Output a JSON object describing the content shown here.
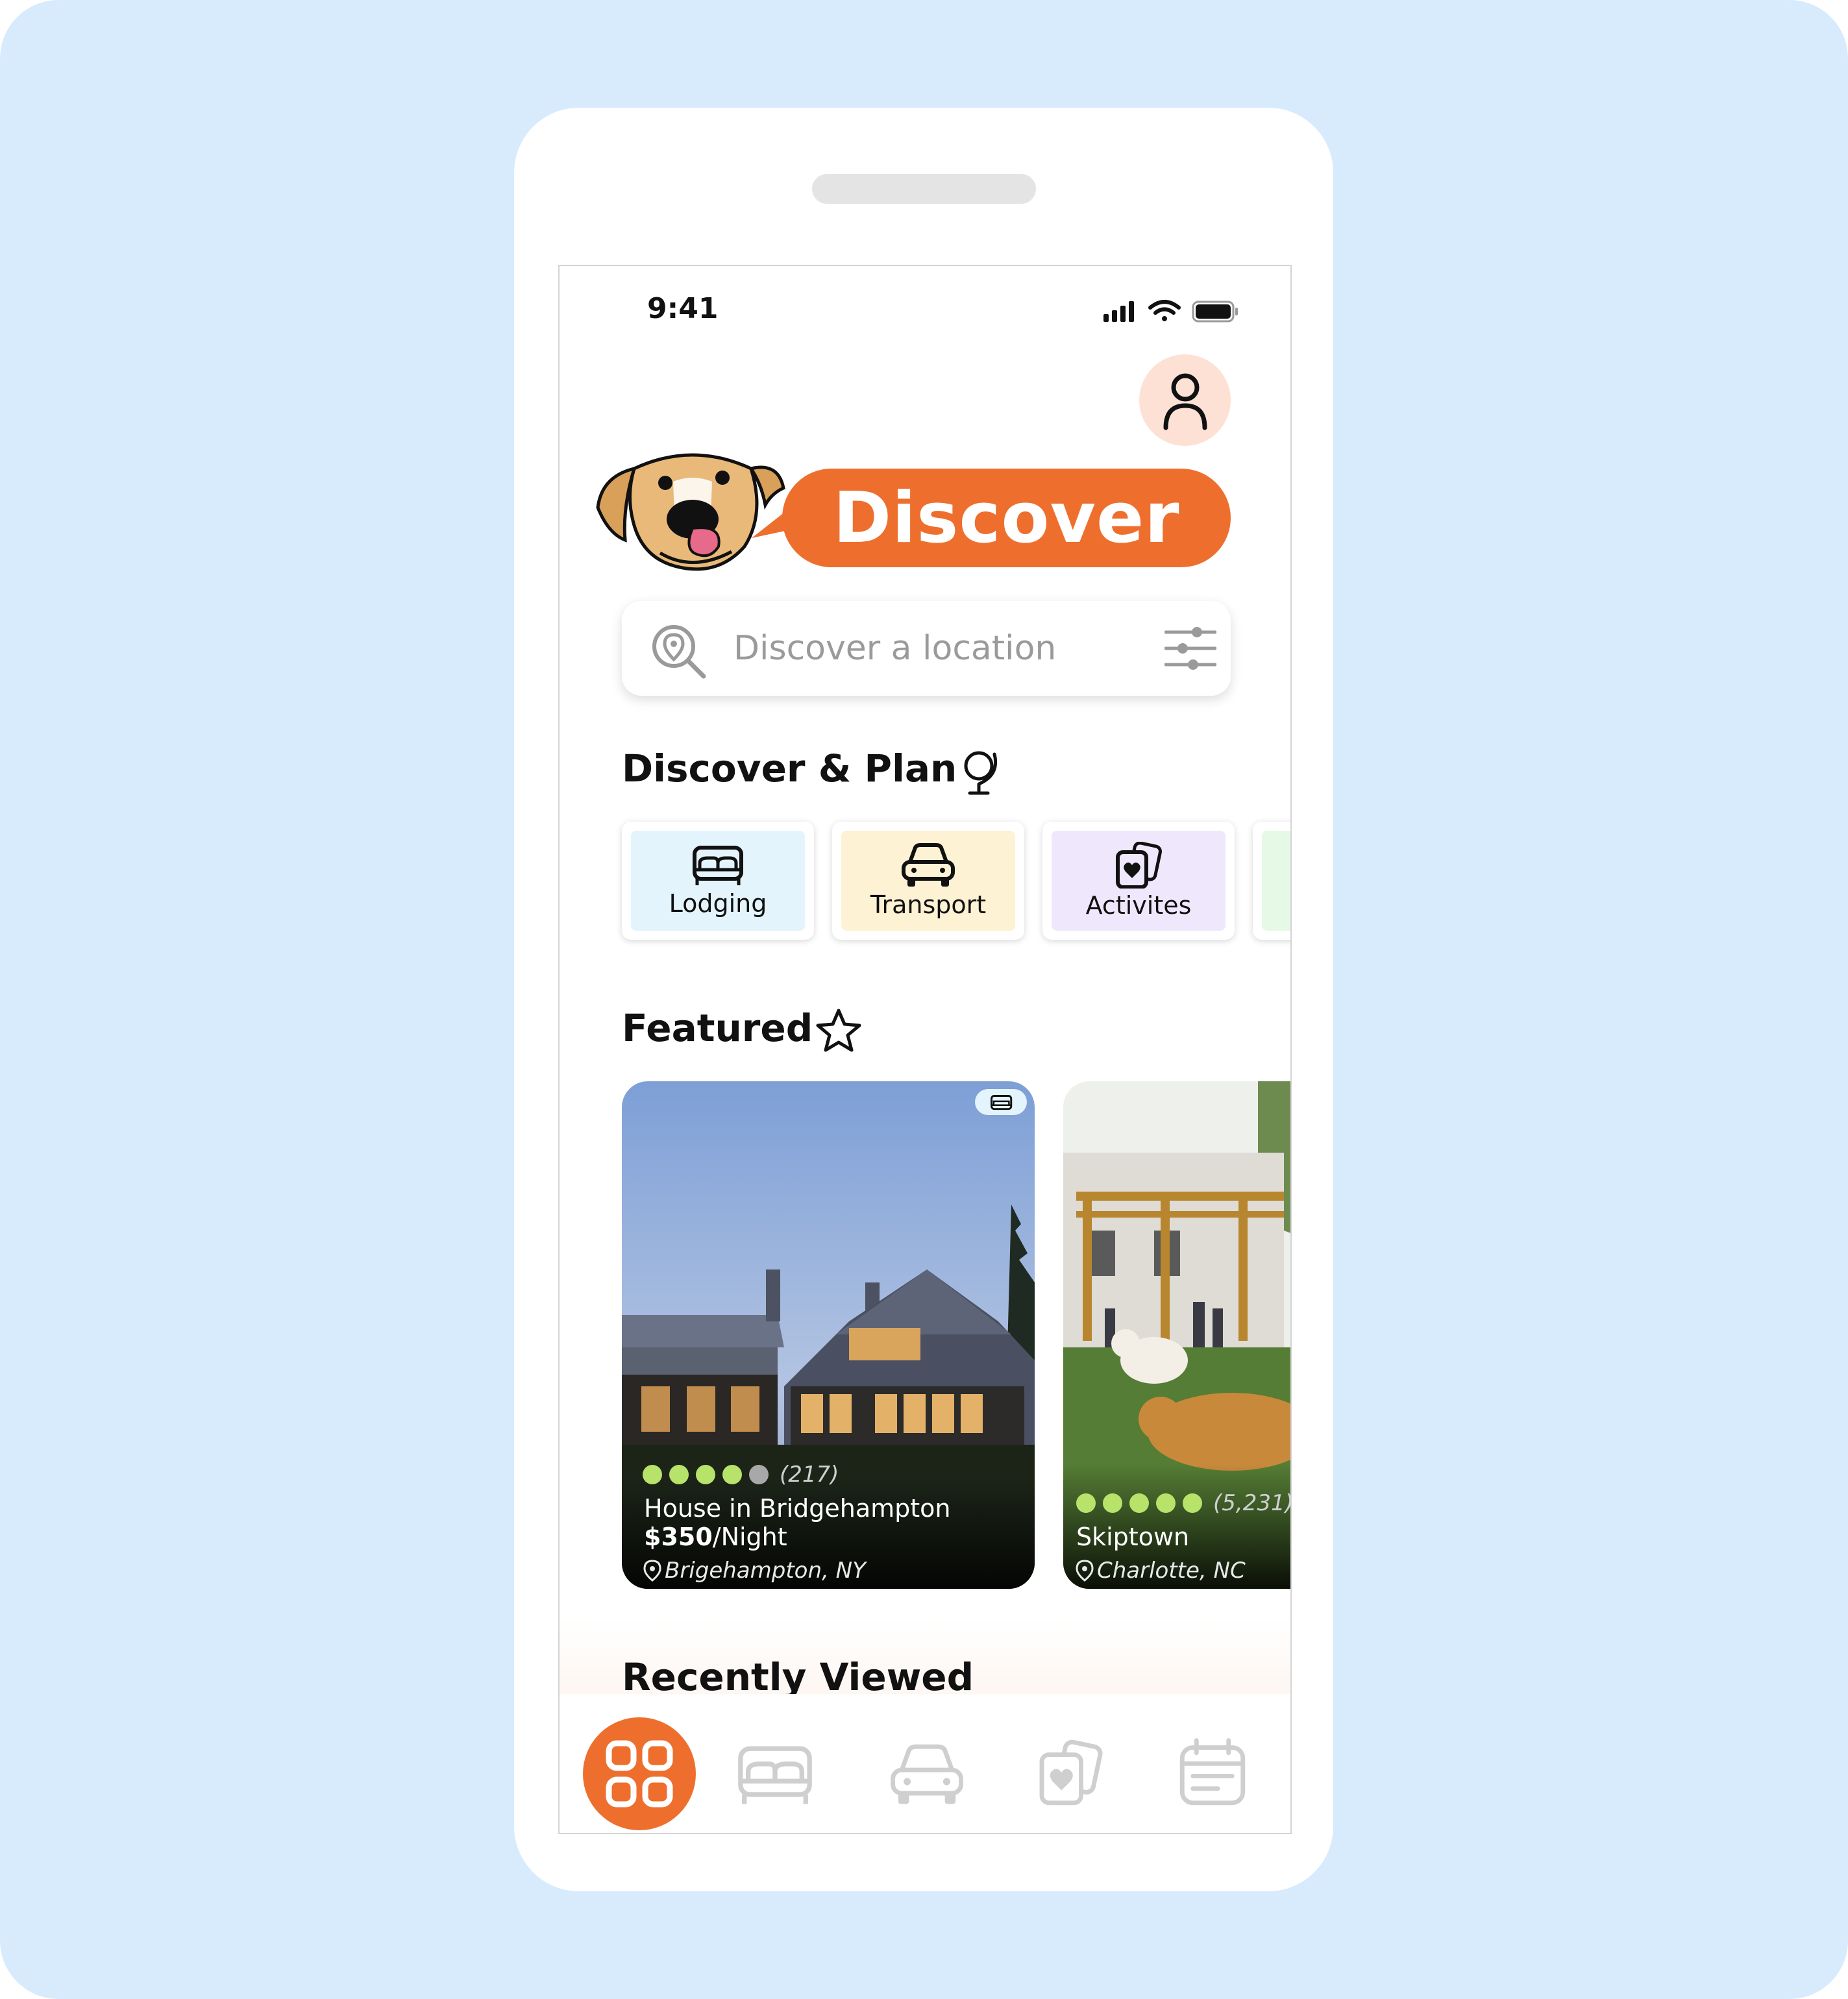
{
  "status_bar": {
    "time": "9:41"
  },
  "header": {
    "title": "Discover"
  },
  "search": {
    "placeholder": "Discover a location"
  },
  "discover_plan": {
    "title": "Discover & Plan",
    "categories": [
      {
        "label": "Lodging",
        "icon": "bed-icon",
        "bg": "#e3f4fd"
      },
      {
        "label": "Transport",
        "icon": "car-icon",
        "bg": "#fef2d4"
      },
      {
        "label": "Activites",
        "icon": "cards-heart-icon",
        "bg": "#efe8fd"
      },
      {
        "label": "",
        "icon": "",
        "bg": "#e6f9e6"
      }
    ]
  },
  "featured": {
    "title": "Featured",
    "cards": [
      {
        "rating_count": "(217)",
        "rating": 4,
        "title": "House in Bridgehampton",
        "price_amount": "$350",
        "price_unit": "/Night",
        "location": "Brigehampton, NY"
      },
      {
        "rating_count": "(5,231)",
        "rating": 5,
        "title": "Skiptown",
        "location": "Charlotte, NC"
      }
    ]
  },
  "recently_viewed": {
    "title": "Recently Viewed"
  },
  "colors": {
    "accent": "#ee6f2d",
    "rating_green": "#b7e36b",
    "tab_inactive": "#cfcfcf"
  },
  "tabbar": {
    "items": [
      "grid-icon",
      "bed-icon",
      "car-icon",
      "cards-heart-icon",
      "calendar-icon"
    ]
  }
}
